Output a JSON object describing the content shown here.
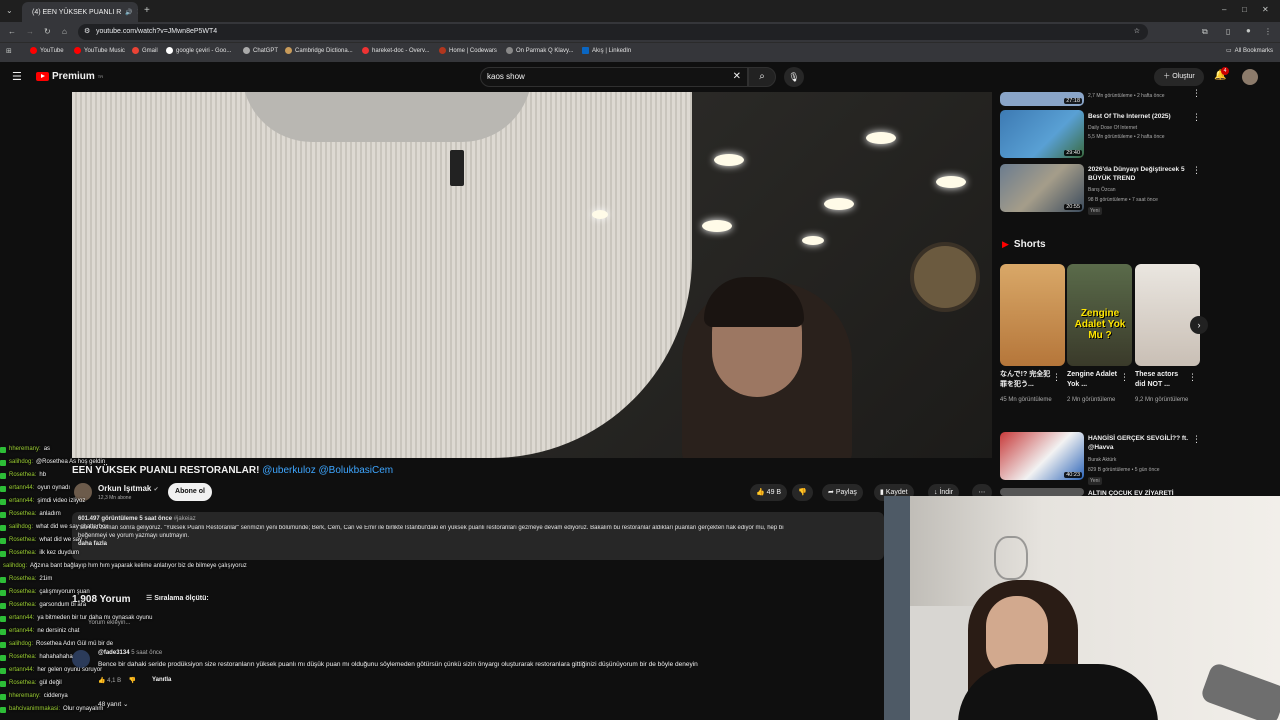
{
  "browser": {
    "tab_title": "(4) EEN YÜKSEK PUANLI R",
    "url": "youtube.com/watch?v=JMwn8eP5WT4",
    "bookmarks": [
      "YouTube",
      "YouTube Music",
      "Gmail",
      "google çeviri - Goo...",
      "ChatGPT",
      "Cambridge Dictiona...",
      "hareket-doc - Overv...",
      "Home | Codewars",
      "On Parmak Q Klavy...",
      "Akış | LinkedIn"
    ],
    "all_bookmarks": "All Bookmarks"
  },
  "header": {
    "logo": "Premium",
    "logo_sup": "TR",
    "search_value": "kaos show",
    "create_label": "Oluştur",
    "notification_count": "4"
  },
  "video": {
    "title_main": "EEN YÜKSEK PUANLI RESTORANLAR!",
    "title_mentions": "@uberkuloz @BolukbasiCem",
    "channel": "Orkun Işıtmak",
    "subscribers": "12,3 Mn abone",
    "subscribe_label": "Abone ol",
    "likes": "49 B",
    "share_label": "Paylaş",
    "save_label": "Kaydet",
    "download_label": "İndir",
    "views_date": "601.497 görüntüleme  5 saat önce",
    "hashtag": "#jakeiaz",
    "description": "\"Bu kez zaman sonra geliyoruz. \"Yüksek Puanlı Restoranlar\" serimizin yeni bölümünde; Berk, Cem, Can ve Emir ile birlikte İstanbul'daki en yüksek puanlı restoranları gezmeye devam ediyoruz. Bakalım bu restoranlar aldıkları puanları gerçekten hak ediyor mu, hep bi",
    "description_2": "beğenmeyi ve yorum yazmayı unutmayın.",
    "more": "daha fazla"
  },
  "comments": {
    "count": "1.908 Yorum",
    "sort_label": "Sıralama ölçütü:",
    "add_placeholder": "Yorum ekleyin...",
    "author": "@fade3134",
    "time": "5 saat önce",
    "text": "Bence bir dahaki seride prodüksiyon size restoranların yüksek puanlı mı düşük puan mı olduğunu söylemeden götürsün çünkü sizin önyargı oluşturarak restoranlara gittiğinizi düşünüyorum bir de böyle deneyin",
    "likes": "4,1 B",
    "reply_label": "Yanıtla",
    "replies": "48 yanıt"
  },
  "chat": [
    {
      "user": "hheremany:",
      "msg": "as"
    },
    {
      "user": "salihdog:",
      "msg": "@Rosethea As hoş geldin"
    },
    {
      "user": "Rosethea:",
      "msg": "hb"
    },
    {
      "user": "ertann44:",
      "msg": "oyun oynadı"
    },
    {
      "user": "ertann44:",
      "msg": "şimdi video izliyoz"
    },
    {
      "user": "Rosethea:",
      "msg": "anladım"
    },
    {
      "user": "salihdog:",
      "msg": "what did we say chatterbox"
    },
    {
      "user": "Rosethea:",
      "msg": "what did we say"
    },
    {
      "user": "Rosethea:",
      "msg": "ilk kez duydum"
    },
    {
      "user": "salihdog:",
      "msg": "Ağzına bant bağlayıp hım hım yaparak kelime anlatıyor biz de bilmeye çalışıyoruz"
    },
    {
      "user": "Rosethea:",
      "msg": "21im"
    },
    {
      "user": "Rosethea:",
      "msg": "çalışmıyorum şuan"
    },
    {
      "user": "Rosethea:",
      "msg": "garsondum bi ara"
    },
    {
      "user": "ertann44:",
      "msg": "ya bitmeden bir tur daha mı oynasak oyunu"
    },
    {
      "user": "ertann44:",
      "msg": "ne dersiniz chat"
    },
    {
      "user": "salihdog:",
      "msg": "Rosethea Adın Gül mü bir de"
    },
    {
      "user": "Rosethea:",
      "msg": "hahahahaha"
    },
    {
      "user": "ertann44:",
      "msg": "her gelen oyunu soruyor"
    },
    {
      "user": "Rosethea:",
      "msg": "gül değil"
    },
    {
      "user": "hheremany:",
      "msg": "ciddenya"
    },
    {
      "user": "bahcivanimmakasi:",
      "msg": "Olur oynayalım"
    }
  ],
  "sidebar": {
    "videos": [
      {
        "title": "",
        "meta": "2,7 Mn görüntüleme • 2 hafta önce",
        "duration": "27:18",
        "color": "#8aa5c8"
      },
      {
        "title": "Best Of The Internet (2025)",
        "channel": "Daily Dose Of Internet",
        "meta": "5,5 Mn görüntüleme • 2 hafta önce",
        "duration": "29:40",
        "color": "#3d7ab3"
      },
      {
        "title": "2026'da Dünyayı Değiştirecek 5 BÜYÜK TREND",
        "channel": "Barış Özcan",
        "meta": "98 B görüntüleme • 7 saat önce",
        "duration": "20:55",
        "badge": "Yeni",
        "color": "#6b7c8f"
      },
      {
        "title": "HANGİSİ GERÇEK SEVGİLİ?? ft. @Havva",
        "channel": "Burak Aktürk",
        "meta": "829 B görüntüleme • 5 gün önce",
        "duration": "40:23",
        "badge": "Yeni",
        "color": "#c73a3a"
      },
      {
        "title": "ALTIN ÇOCUK EV ZİYARETİ",
        "meta": "",
        "duration": "",
        "color": "#555"
      }
    ],
    "shorts_title": "Shorts",
    "shorts": [
      {
        "title": "なんで!? 完全犯罪を犯う...",
        "meta": "45 Mn görüntüleme",
        "color": "#c08a4a"
      },
      {
        "title": "Zengine Adalet Yok ...",
        "meta": "2 Mn görüntüleme",
        "overlay": "Zengine Adalet Yok Mu ?",
        "color": "#5a6b4a"
      },
      {
        "title": "These actors did NOT ...",
        "meta": "9,2 Mn görüntüleme",
        "color": "#d9d3cc"
      }
    ]
  }
}
